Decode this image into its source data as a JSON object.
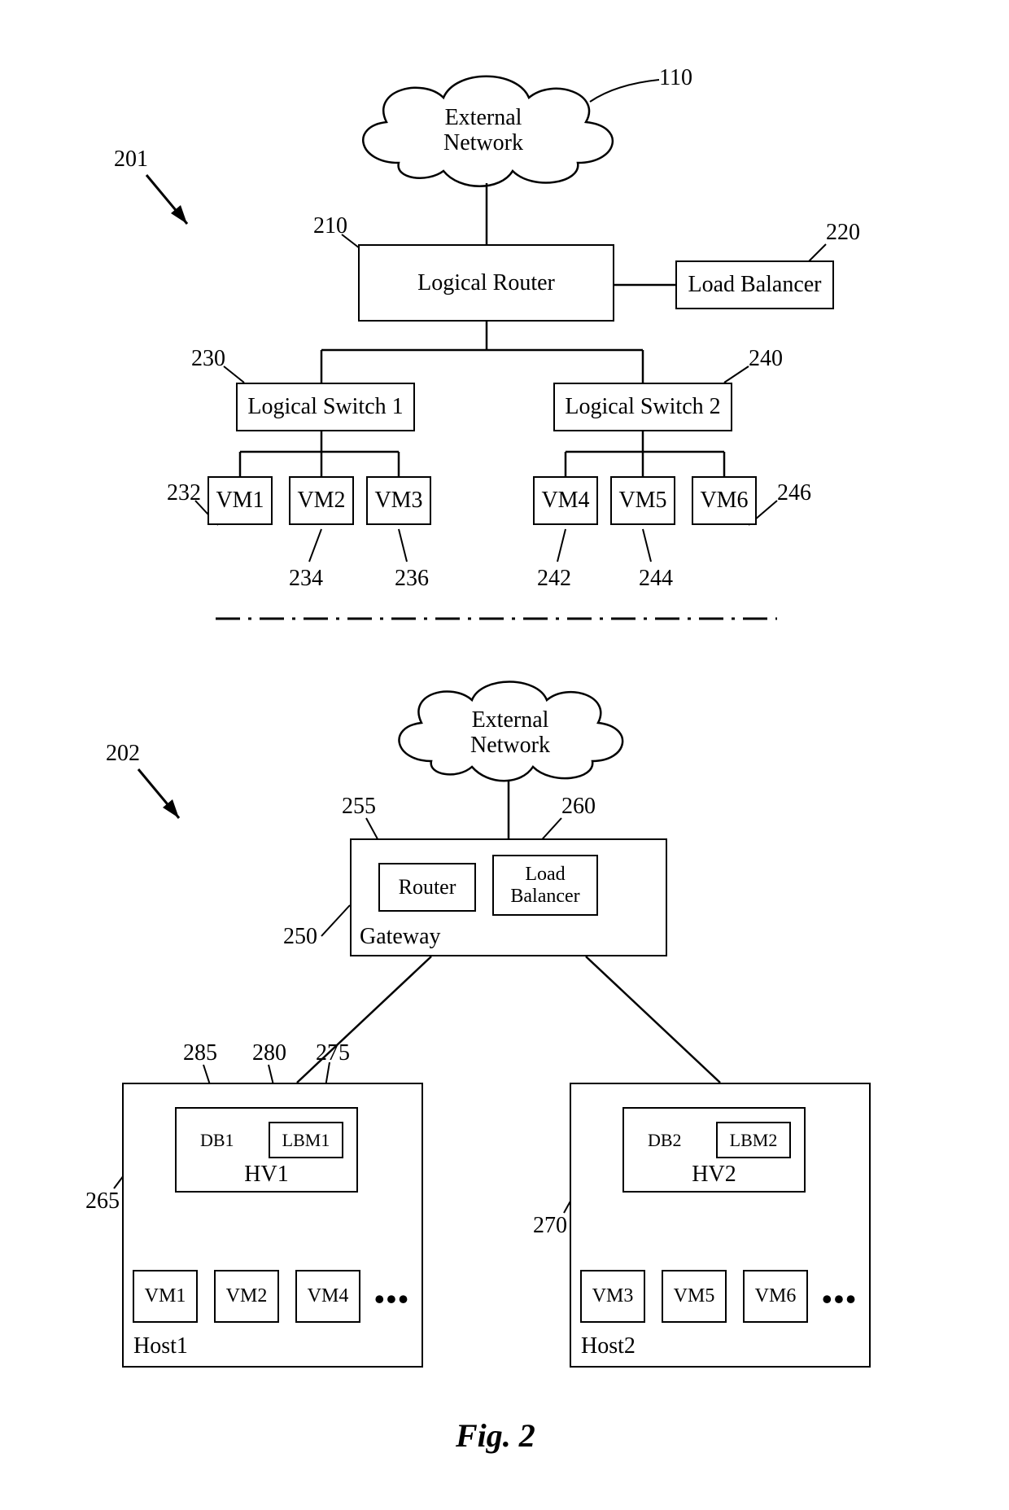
{
  "figure_label": "Fig. 2",
  "top": {
    "ref_main": "201",
    "cloud_label": "External\nNetwork",
    "cloud_ref": "110",
    "router_label": "Logical Router",
    "router_ref": "210",
    "lb_label": "Load Balancer",
    "lb_ref": "220",
    "sw1_label": "Logical Switch 1",
    "sw1_ref": "230",
    "sw2_label": "Logical Switch 2",
    "sw2_ref": "240",
    "vm1": "VM1",
    "vm1_ref": "232",
    "vm2": "VM2",
    "vm2_ref": "234",
    "vm3": "VM3",
    "vm3_ref": "236",
    "vm4": "VM4",
    "vm4_ref": "242",
    "vm5": "VM5",
    "vm5_ref": "244",
    "vm6": "VM6",
    "vm6_ref": "246"
  },
  "bottom": {
    "ref_main": "202",
    "cloud_label": "External\nNetwork",
    "gateway_label": "Gateway",
    "gateway_ref": "250",
    "router_label": "Router",
    "router_ref": "255",
    "lb_label": "Load\nBalancer",
    "lb_ref": "260",
    "host1_label": "Host1",
    "host1_ref": "265",
    "hv1_label": "HV1",
    "hv1_ref": "275",
    "lbm1_label": "LBM1",
    "lbm1_ref": "280",
    "db1_label": "DB1",
    "db1_ref": "285",
    "host1_vm1": "VM1",
    "host1_vm2": "VM2",
    "host1_vm3": "VM4",
    "host2_label": "Host2",
    "host2_ref": "270",
    "hv2_label": "HV2",
    "lbm2_label": "LBM2",
    "db2_label": "DB2",
    "host2_vm1": "VM3",
    "host2_vm2": "VM5",
    "host2_vm3": "VM6"
  }
}
